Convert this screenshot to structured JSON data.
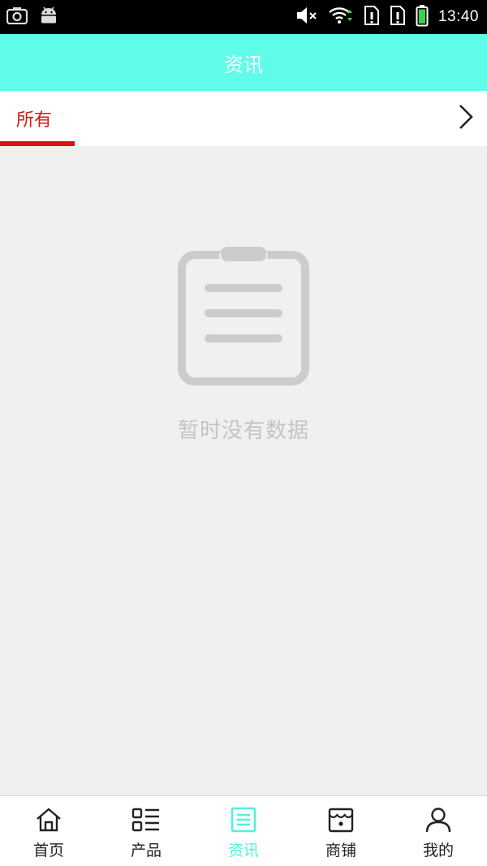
{
  "status_bar": {
    "time": "13:40",
    "left_icons": [
      "screenshot-icon",
      "android-icon"
    ],
    "right_icons": [
      "volume-muted-icon",
      "wifi-icon",
      "sim-alert-icon",
      "sim-alert-icon",
      "battery-icon"
    ]
  },
  "app_bar": {
    "title": "资讯",
    "background": "#61fbe9"
  },
  "tabs": {
    "items": [
      {
        "label": "所有",
        "active": true
      }
    ],
    "more_icon": "chevron-right-icon",
    "active_color": "#cc1b1b"
  },
  "empty_state": {
    "icon": "clipboard-icon",
    "message": "暂时没有数据"
  },
  "bottom_nav": {
    "items": [
      {
        "label": "首页",
        "icon": "home-icon",
        "active": false
      },
      {
        "label": "产品",
        "icon": "list-grid-icon",
        "active": false
      },
      {
        "label": "资讯",
        "icon": "news-icon",
        "active": true
      },
      {
        "label": "商铺",
        "icon": "store-icon",
        "active": false
      },
      {
        "label": "我的",
        "icon": "user-icon",
        "active": false
      }
    ],
    "active_color": "#4ff2e0"
  }
}
